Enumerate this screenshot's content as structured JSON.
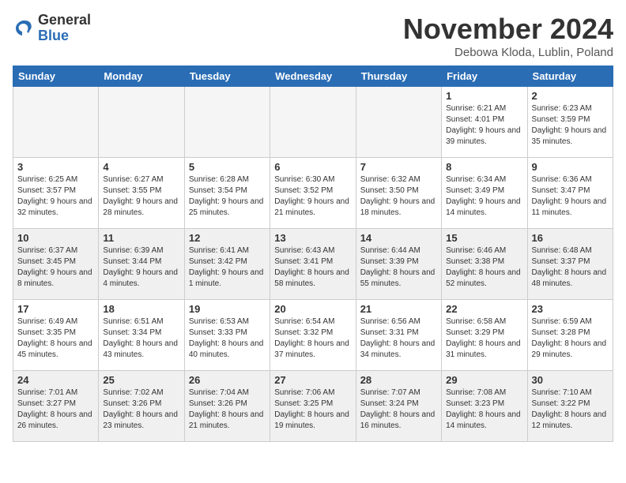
{
  "header": {
    "logo_general": "General",
    "logo_blue": "Blue",
    "month": "November 2024",
    "location": "Debowa Kloda, Lublin, Poland"
  },
  "weekdays": [
    "Sunday",
    "Monday",
    "Tuesday",
    "Wednesday",
    "Thursday",
    "Friday",
    "Saturday"
  ],
  "weeks": [
    [
      {
        "day": "",
        "info": ""
      },
      {
        "day": "",
        "info": ""
      },
      {
        "day": "",
        "info": ""
      },
      {
        "day": "",
        "info": ""
      },
      {
        "day": "",
        "info": ""
      },
      {
        "day": "1",
        "info": "Sunrise: 6:21 AM\nSunset: 4:01 PM\nDaylight: 9 hours and 39 minutes."
      },
      {
        "day": "2",
        "info": "Sunrise: 6:23 AM\nSunset: 3:59 PM\nDaylight: 9 hours and 35 minutes."
      }
    ],
    [
      {
        "day": "3",
        "info": "Sunrise: 6:25 AM\nSunset: 3:57 PM\nDaylight: 9 hours and 32 minutes."
      },
      {
        "day": "4",
        "info": "Sunrise: 6:27 AM\nSunset: 3:55 PM\nDaylight: 9 hours and 28 minutes."
      },
      {
        "day": "5",
        "info": "Sunrise: 6:28 AM\nSunset: 3:54 PM\nDaylight: 9 hours and 25 minutes."
      },
      {
        "day": "6",
        "info": "Sunrise: 6:30 AM\nSunset: 3:52 PM\nDaylight: 9 hours and 21 minutes."
      },
      {
        "day": "7",
        "info": "Sunrise: 6:32 AM\nSunset: 3:50 PM\nDaylight: 9 hours and 18 minutes."
      },
      {
        "day": "8",
        "info": "Sunrise: 6:34 AM\nSunset: 3:49 PM\nDaylight: 9 hours and 14 minutes."
      },
      {
        "day": "9",
        "info": "Sunrise: 6:36 AM\nSunset: 3:47 PM\nDaylight: 9 hours and 11 minutes."
      }
    ],
    [
      {
        "day": "10",
        "info": "Sunrise: 6:37 AM\nSunset: 3:45 PM\nDaylight: 9 hours and 8 minutes."
      },
      {
        "day": "11",
        "info": "Sunrise: 6:39 AM\nSunset: 3:44 PM\nDaylight: 9 hours and 4 minutes."
      },
      {
        "day": "12",
        "info": "Sunrise: 6:41 AM\nSunset: 3:42 PM\nDaylight: 9 hours and 1 minute."
      },
      {
        "day": "13",
        "info": "Sunrise: 6:43 AM\nSunset: 3:41 PM\nDaylight: 8 hours and 58 minutes."
      },
      {
        "day": "14",
        "info": "Sunrise: 6:44 AM\nSunset: 3:39 PM\nDaylight: 8 hours and 55 minutes."
      },
      {
        "day": "15",
        "info": "Sunrise: 6:46 AM\nSunset: 3:38 PM\nDaylight: 8 hours and 52 minutes."
      },
      {
        "day": "16",
        "info": "Sunrise: 6:48 AM\nSunset: 3:37 PM\nDaylight: 8 hours and 48 minutes."
      }
    ],
    [
      {
        "day": "17",
        "info": "Sunrise: 6:49 AM\nSunset: 3:35 PM\nDaylight: 8 hours and 45 minutes."
      },
      {
        "day": "18",
        "info": "Sunrise: 6:51 AM\nSunset: 3:34 PM\nDaylight: 8 hours and 43 minutes."
      },
      {
        "day": "19",
        "info": "Sunrise: 6:53 AM\nSunset: 3:33 PM\nDaylight: 8 hours and 40 minutes."
      },
      {
        "day": "20",
        "info": "Sunrise: 6:54 AM\nSunset: 3:32 PM\nDaylight: 8 hours and 37 minutes."
      },
      {
        "day": "21",
        "info": "Sunrise: 6:56 AM\nSunset: 3:31 PM\nDaylight: 8 hours and 34 minutes."
      },
      {
        "day": "22",
        "info": "Sunrise: 6:58 AM\nSunset: 3:29 PM\nDaylight: 8 hours and 31 minutes."
      },
      {
        "day": "23",
        "info": "Sunrise: 6:59 AM\nSunset: 3:28 PM\nDaylight: 8 hours and 29 minutes."
      }
    ],
    [
      {
        "day": "24",
        "info": "Sunrise: 7:01 AM\nSunset: 3:27 PM\nDaylight: 8 hours and 26 minutes."
      },
      {
        "day": "25",
        "info": "Sunrise: 7:02 AM\nSunset: 3:26 PM\nDaylight: 8 hours and 23 minutes."
      },
      {
        "day": "26",
        "info": "Sunrise: 7:04 AM\nSunset: 3:26 PM\nDaylight: 8 hours and 21 minutes."
      },
      {
        "day": "27",
        "info": "Sunrise: 7:06 AM\nSunset: 3:25 PM\nDaylight: 8 hours and 19 minutes."
      },
      {
        "day": "28",
        "info": "Sunrise: 7:07 AM\nSunset: 3:24 PM\nDaylight: 8 hours and 16 minutes."
      },
      {
        "day": "29",
        "info": "Sunrise: 7:08 AM\nSunset: 3:23 PM\nDaylight: 8 hours and 14 minutes."
      },
      {
        "day": "30",
        "info": "Sunrise: 7:10 AM\nSunset: 3:22 PM\nDaylight: 8 hours and 12 minutes."
      }
    ]
  ]
}
